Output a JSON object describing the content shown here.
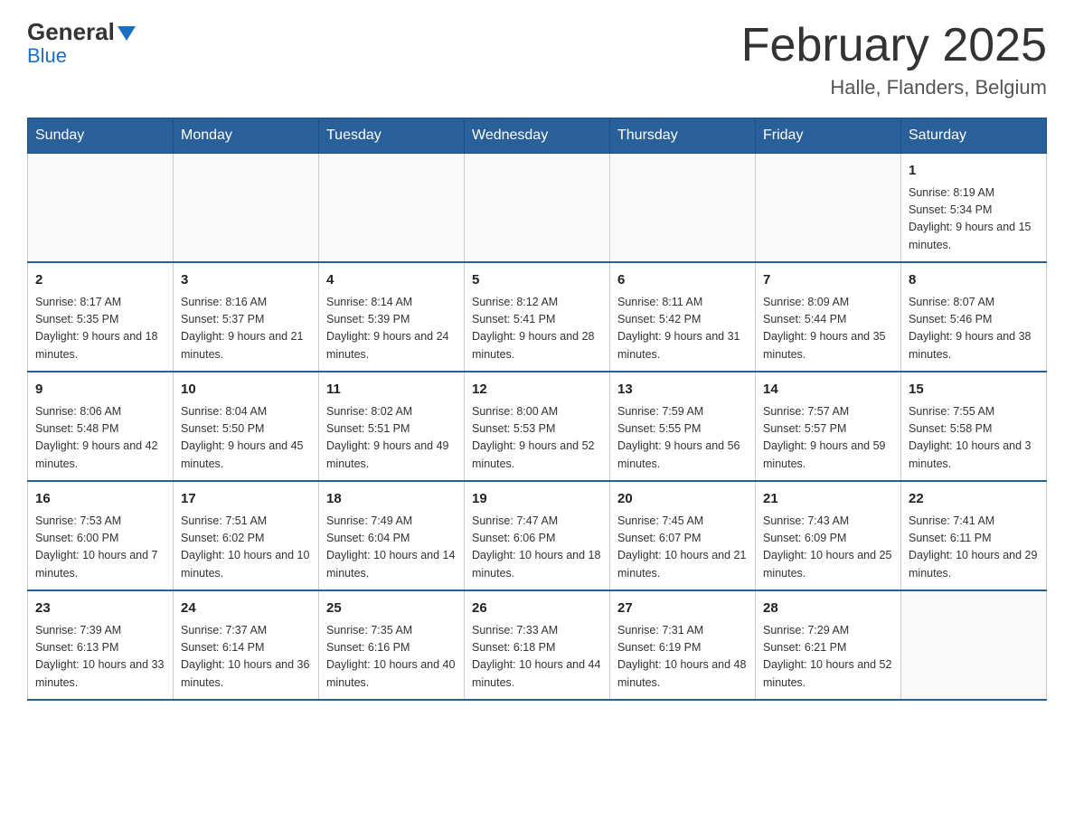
{
  "header": {
    "logo": {
      "general": "General",
      "blue": "Blue"
    },
    "title": "February 2025",
    "location": "Halle, Flanders, Belgium"
  },
  "days_of_week": [
    "Sunday",
    "Monday",
    "Tuesday",
    "Wednesday",
    "Thursday",
    "Friday",
    "Saturday"
  ],
  "weeks": [
    [
      null,
      null,
      null,
      null,
      null,
      null,
      {
        "day": "1",
        "sunrise": "Sunrise: 8:19 AM",
        "sunset": "Sunset: 5:34 PM",
        "daylight": "Daylight: 9 hours and 15 minutes."
      }
    ],
    [
      {
        "day": "2",
        "sunrise": "Sunrise: 8:17 AM",
        "sunset": "Sunset: 5:35 PM",
        "daylight": "Daylight: 9 hours and 18 minutes."
      },
      {
        "day": "3",
        "sunrise": "Sunrise: 8:16 AM",
        "sunset": "Sunset: 5:37 PM",
        "daylight": "Daylight: 9 hours and 21 minutes."
      },
      {
        "day": "4",
        "sunrise": "Sunrise: 8:14 AM",
        "sunset": "Sunset: 5:39 PM",
        "daylight": "Daylight: 9 hours and 24 minutes."
      },
      {
        "day": "5",
        "sunrise": "Sunrise: 8:12 AM",
        "sunset": "Sunset: 5:41 PM",
        "daylight": "Daylight: 9 hours and 28 minutes."
      },
      {
        "day": "6",
        "sunrise": "Sunrise: 8:11 AM",
        "sunset": "Sunset: 5:42 PM",
        "daylight": "Daylight: 9 hours and 31 minutes."
      },
      {
        "day": "7",
        "sunrise": "Sunrise: 8:09 AM",
        "sunset": "Sunset: 5:44 PM",
        "daylight": "Daylight: 9 hours and 35 minutes."
      },
      {
        "day": "8",
        "sunrise": "Sunrise: 8:07 AM",
        "sunset": "Sunset: 5:46 PM",
        "daylight": "Daylight: 9 hours and 38 minutes."
      }
    ],
    [
      {
        "day": "9",
        "sunrise": "Sunrise: 8:06 AM",
        "sunset": "Sunset: 5:48 PM",
        "daylight": "Daylight: 9 hours and 42 minutes."
      },
      {
        "day": "10",
        "sunrise": "Sunrise: 8:04 AM",
        "sunset": "Sunset: 5:50 PM",
        "daylight": "Daylight: 9 hours and 45 minutes."
      },
      {
        "day": "11",
        "sunrise": "Sunrise: 8:02 AM",
        "sunset": "Sunset: 5:51 PM",
        "daylight": "Daylight: 9 hours and 49 minutes."
      },
      {
        "day": "12",
        "sunrise": "Sunrise: 8:00 AM",
        "sunset": "Sunset: 5:53 PM",
        "daylight": "Daylight: 9 hours and 52 minutes."
      },
      {
        "day": "13",
        "sunrise": "Sunrise: 7:59 AM",
        "sunset": "Sunset: 5:55 PM",
        "daylight": "Daylight: 9 hours and 56 minutes."
      },
      {
        "day": "14",
        "sunrise": "Sunrise: 7:57 AM",
        "sunset": "Sunset: 5:57 PM",
        "daylight": "Daylight: 9 hours and 59 minutes."
      },
      {
        "day": "15",
        "sunrise": "Sunrise: 7:55 AM",
        "sunset": "Sunset: 5:58 PM",
        "daylight": "Daylight: 10 hours and 3 minutes."
      }
    ],
    [
      {
        "day": "16",
        "sunrise": "Sunrise: 7:53 AM",
        "sunset": "Sunset: 6:00 PM",
        "daylight": "Daylight: 10 hours and 7 minutes."
      },
      {
        "day": "17",
        "sunrise": "Sunrise: 7:51 AM",
        "sunset": "Sunset: 6:02 PM",
        "daylight": "Daylight: 10 hours and 10 minutes."
      },
      {
        "day": "18",
        "sunrise": "Sunrise: 7:49 AM",
        "sunset": "Sunset: 6:04 PM",
        "daylight": "Daylight: 10 hours and 14 minutes."
      },
      {
        "day": "19",
        "sunrise": "Sunrise: 7:47 AM",
        "sunset": "Sunset: 6:06 PM",
        "daylight": "Daylight: 10 hours and 18 minutes."
      },
      {
        "day": "20",
        "sunrise": "Sunrise: 7:45 AM",
        "sunset": "Sunset: 6:07 PM",
        "daylight": "Daylight: 10 hours and 21 minutes."
      },
      {
        "day": "21",
        "sunrise": "Sunrise: 7:43 AM",
        "sunset": "Sunset: 6:09 PM",
        "daylight": "Daylight: 10 hours and 25 minutes."
      },
      {
        "day": "22",
        "sunrise": "Sunrise: 7:41 AM",
        "sunset": "Sunset: 6:11 PM",
        "daylight": "Daylight: 10 hours and 29 minutes."
      }
    ],
    [
      {
        "day": "23",
        "sunrise": "Sunrise: 7:39 AM",
        "sunset": "Sunset: 6:13 PM",
        "daylight": "Daylight: 10 hours and 33 minutes."
      },
      {
        "day": "24",
        "sunrise": "Sunrise: 7:37 AM",
        "sunset": "Sunset: 6:14 PM",
        "daylight": "Daylight: 10 hours and 36 minutes."
      },
      {
        "day": "25",
        "sunrise": "Sunrise: 7:35 AM",
        "sunset": "Sunset: 6:16 PM",
        "daylight": "Daylight: 10 hours and 40 minutes."
      },
      {
        "day": "26",
        "sunrise": "Sunrise: 7:33 AM",
        "sunset": "Sunset: 6:18 PM",
        "daylight": "Daylight: 10 hours and 44 minutes."
      },
      {
        "day": "27",
        "sunrise": "Sunrise: 7:31 AM",
        "sunset": "Sunset: 6:19 PM",
        "daylight": "Daylight: 10 hours and 48 minutes."
      },
      {
        "day": "28",
        "sunrise": "Sunrise: 7:29 AM",
        "sunset": "Sunset: 6:21 PM",
        "daylight": "Daylight: 10 hours and 52 minutes."
      },
      null
    ]
  ]
}
